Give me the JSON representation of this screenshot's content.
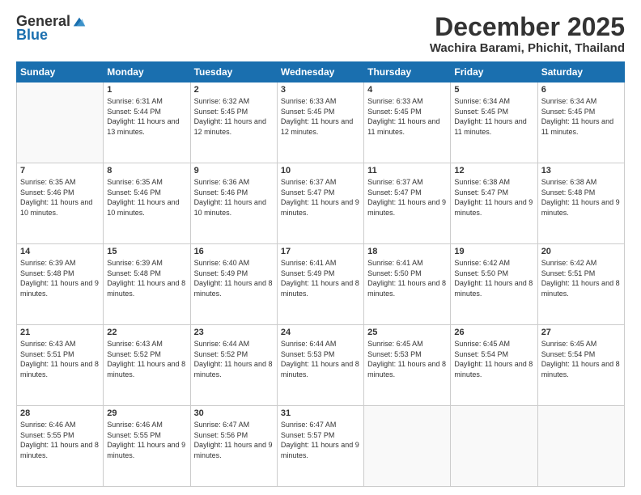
{
  "logo": {
    "general": "General",
    "blue": "Blue"
  },
  "title": "December 2025",
  "location": "Wachira Barami, Phichit, Thailand",
  "days_of_week": [
    "Sunday",
    "Monday",
    "Tuesday",
    "Wednesday",
    "Thursday",
    "Friday",
    "Saturday"
  ],
  "weeks": [
    [
      {
        "day": "",
        "empty": true
      },
      {
        "day": "1",
        "sunrise": "6:31 AM",
        "sunset": "5:44 PM",
        "daylight": "11 hours and 13 minutes."
      },
      {
        "day": "2",
        "sunrise": "6:32 AM",
        "sunset": "5:45 PM",
        "daylight": "11 hours and 12 minutes."
      },
      {
        "day": "3",
        "sunrise": "6:33 AM",
        "sunset": "5:45 PM",
        "daylight": "11 hours and 12 minutes."
      },
      {
        "day": "4",
        "sunrise": "6:33 AM",
        "sunset": "5:45 PM",
        "daylight": "11 hours and 11 minutes."
      },
      {
        "day": "5",
        "sunrise": "6:34 AM",
        "sunset": "5:45 PM",
        "daylight": "11 hours and 11 minutes."
      },
      {
        "day": "6",
        "sunrise": "6:34 AM",
        "sunset": "5:45 PM",
        "daylight": "11 hours and 11 minutes."
      }
    ],
    [
      {
        "day": "7",
        "sunrise": "6:35 AM",
        "sunset": "5:46 PM",
        "daylight": "11 hours and 10 minutes."
      },
      {
        "day": "8",
        "sunrise": "6:35 AM",
        "sunset": "5:46 PM",
        "daylight": "11 hours and 10 minutes."
      },
      {
        "day": "9",
        "sunrise": "6:36 AM",
        "sunset": "5:46 PM",
        "daylight": "11 hours and 10 minutes."
      },
      {
        "day": "10",
        "sunrise": "6:37 AM",
        "sunset": "5:47 PM",
        "daylight": "11 hours and 9 minutes."
      },
      {
        "day": "11",
        "sunrise": "6:37 AM",
        "sunset": "5:47 PM",
        "daylight": "11 hours and 9 minutes."
      },
      {
        "day": "12",
        "sunrise": "6:38 AM",
        "sunset": "5:47 PM",
        "daylight": "11 hours and 9 minutes."
      },
      {
        "day": "13",
        "sunrise": "6:38 AM",
        "sunset": "5:48 PM",
        "daylight": "11 hours and 9 minutes."
      }
    ],
    [
      {
        "day": "14",
        "sunrise": "6:39 AM",
        "sunset": "5:48 PM",
        "daylight": "11 hours and 9 minutes."
      },
      {
        "day": "15",
        "sunrise": "6:39 AM",
        "sunset": "5:48 PM",
        "daylight": "11 hours and 8 minutes."
      },
      {
        "day": "16",
        "sunrise": "6:40 AM",
        "sunset": "5:49 PM",
        "daylight": "11 hours and 8 minutes."
      },
      {
        "day": "17",
        "sunrise": "6:41 AM",
        "sunset": "5:49 PM",
        "daylight": "11 hours and 8 minutes."
      },
      {
        "day": "18",
        "sunrise": "6:41 AM",
        "sunset": "5:50 PM",
        "daylight": "11 hours and 8 minutes."
      },
      {
        "day": "19",
        "sunrise": "6:42 AM",
        "sunset": "5:50 PM",
        "daylight": "11 hours and 8 minutes."
      },
      {
        "day": "20",
        "sunrise": "6:42 AM",
        "sunset": "5:51 PM",
        "daylight": "11 hours and 8 minutes."
      }
    ],
    [
      {
        "day": "21",
        "sunrise": "6:43 AM",
        "sunset": "5:51 PM",
        "daylight": "11 hours and 8 minutes."
      },
      {
        "day": "22",
        "sunrise": "6:43 AM",
        "sunset": "5:52 PM",
        "daylight": "11 hours and 8 minutes."
      },
      {
        "day": "23",
        "sunrise": "6:44 AM",
        "sunset": "5:52 PM",
        "daylight": "11 hours and 8 minutes."
      },
      {
        "day": "24",
        "sunrise": "6:44 AM",
        "sunset": "5:53 PM",
        "daylight": "11 hours and 8 minutes."
      },
      {
        "day": "25",
        "sunrise": "6:45 AM",
        "sunset": "5:53 PM",
        "daylight": "11 hours and 8 minutes."
      },
      {
        "day": "26",
        "sunrise": "6:45 AM",
        "sunset": "5:54 PM",
        "daylight": "11 hours and 8 minutes."
      },
      {
        "day": "27",
        "sunrise": "6:45 AM",
        "sunset": "5:54 PM",
        "daylight": "11 hours and 8 minutes."
      }
    ],
    [
      {
        "day": "28",
        "sunrise": "6:46 AM",
        "sunset": "5:55 PM",
        "daylight": "11 hours and 8 minutes."
      },
      {
        "day": "29",
        "sunrise": "6:46 AM",
        "sunset": "5:55 PM",
        "daylight": "11 hours and 9 minutes."
      },
      {
        "day": "30",
        "sunrise": "6:47 AM",
        "sunset": "5:56 PM",
        "daylight": "11 hours and 9 minutes."
      },
      {
        "day": "31",
        "sunrise": "6:47 AM",
        "sunset": "5:57 PM",
        "daylight": "11 hours and 9 minutes."
      },
      {
        "day": "",
        "empty": true
      },
      {
        "day": "",
        "empty": true
      },
      {
        "day": "",
        "empty": true
      }
    ]
  ]
}
